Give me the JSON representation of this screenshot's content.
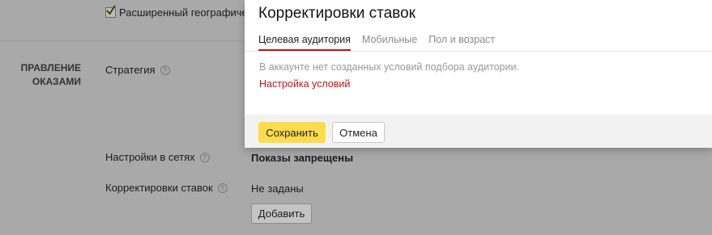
{
  "background": {
    "geo_checkbox": {
      "checked": true,
      "label": "Расширенный географичес"
    },
    "section": {
      "title_line1": "ПРАВЛЕНИЕ",
      "title_line2": "ОКАЗАМИ"
    },
    "strategy": {
      "label": "Стратегия"
    },
    "network_settings": {
      "label": "Настройки в сетях",
      "value": "Показы запрещены"
    },
    "bid_adjustments": {
      "label": "Корректировки ставок",
      "value": "Не заданы",
      "add_button": "Добавить"
    },
    "help_glyph": "?"
  },
  "modal": {
    "title": "Корректировки ставок",
    "tabs": [
      {
        "label": "Целевая аудитория",
        "active": true
      },
      {
        "label": "Мобильные",
        "active": false
      },
      {
        "label": "Пол и возраст",
        "active": false
      }
    ],
    "empty_text": "В аккаунте нет созданных условий подбора аудитории.",
    "settings_link": "Настройка условий",
    "save_button": "Сохранить",
    "cancel_button": "Отмена"
  },
  "colors": {
    "overlay": "#a9a9a9",
    "accent_red": "#c5131a",
    "save_yellow": "#ffdb4d",
    "footer_bg": "#f2f2f2"
  }
}
